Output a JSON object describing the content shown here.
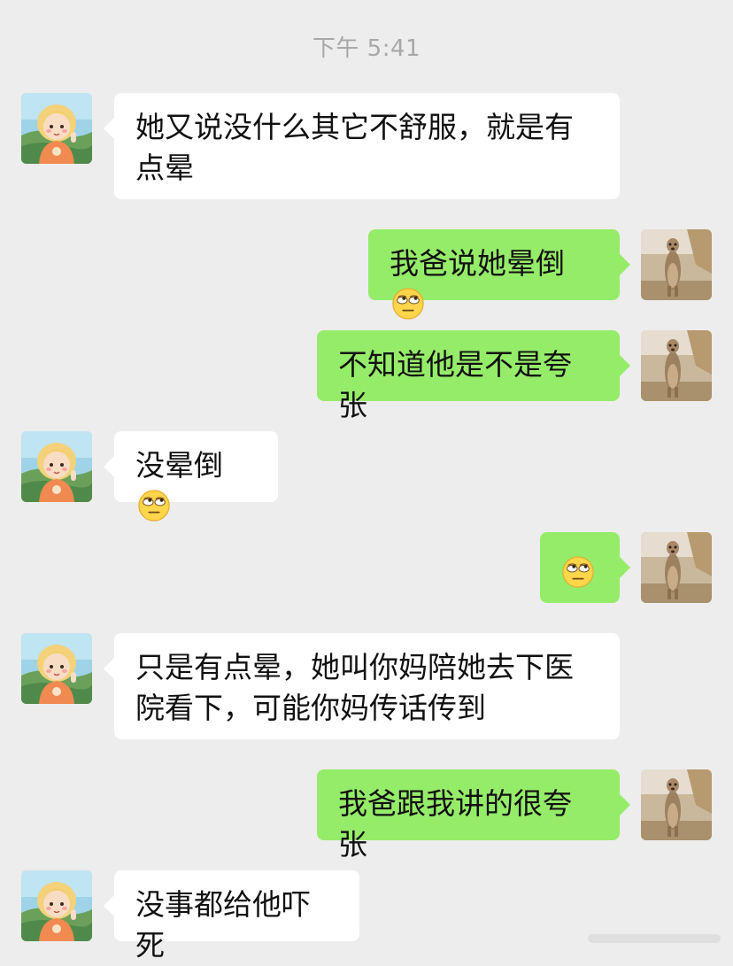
{
  "timestamp": "下午 5:41",
  "messages": [
    {
      "side": "recv",
      "text": "她又说没什么其它不舒服，就是有点晕"
    },
    {
      "side": "sent",
      "text": "我爸说她晕倒",
      "emoji": "eye-roll-emoji"
    },
    {
      "side": "sent",
      "text": "不知道他是不是夸张"
    },
    {
      "side": "recv",
      "text": "没晕倒",
      "emoji": "eye-roll-emoji"
    },
    {
      "side": "sent",
      "text": "",
      "emoji": "eye-roll-emoji"
    },
    {
      "side": "recv",
      "text": "只是有点晕，她叫你妈陪她去下医院看下，可能你妈传话传到"
    },
    {
      "side": "sent",
      "text": "我爸跟我讲的很夸张"
    },
    {
      "side": "recv",
      "text": "没事都给他吓死"
    }
  ],
  "colors": {
    "background": "#ededed",
    "received_bubble": "#ffffff",
    "sent_bubble": "#95ec69",
    "timestamp_text": "#a8a8a8"
  },
  "icons": {
    "contact_avatar": "cartoon-girl-avatar-icon",
    "self_avatar": "meerkat-photo-avatar-icon",
    "emoji": "eye-roll-emoji"
  }
}
